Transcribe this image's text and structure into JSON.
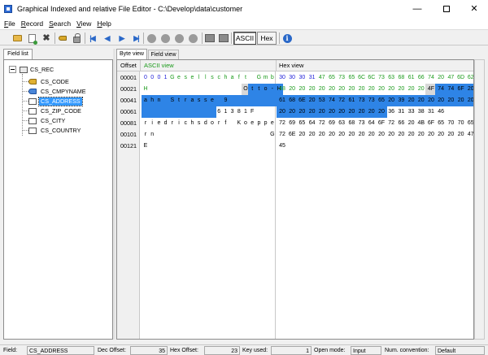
{
  "window": {
    "title": "Graphical Indexed and relative File Editor - C:\\Develop\\data\\customer",
    "min_glyph": "—",
    "close_glyph": "✕",
    "app_icon": "app-icon"
  },
  "menu": [
    "File",
    "Record",
    "Search",
    "View",
    "Help"
  ],
  "toolbar": {
    "icons": [
      "open-folder-icon",
      "new-document-icon",
      "delete-icon",
      "key-icon",
      "lock-icon",
      "first-record-icon",
      "previous-record-icon",
      "next-record-icon",
      "last-record-icon",
      "circle-icon",
      "circle-icon",
      "circle-icon",
      "circle-icon",
      "progress-icon",
      "progress-icon",
      "info-icon"
    ],
    "ascii_label": "ASCII",
    "hex_label": "Hex",
    "info_glyph": "i"
  },
  "left_tab": "Field list",
  "tree": {
    "root": "CS_REC",
    "items": [
      {
        "label": "CS_CODE",
        "icon": "key-icon"
      },
      {
        "label": "CS_CMPYNAME",
        "icon": "key-icon-blue"
      },
      {
        "label": "CS_ADDRESS",
        "icon": "field-icon",
        "selected": true
      },
      {
        "label": "CS_ZIP_CODE",
        "icon": "field-icon"
      },
      {
        "label": "CS_CITY",
        "icon": "field-icon"
      },
      {
        "label": "CS_COUNTRY",
        "icon": "field-icon"
      }
    ]
  },
  "view_tabs": {
    "byte": "Byte view",
    "field": "Field view"
  },
  "grid": {
    "offset_header": "Offset",
    "ascii_header": "ASCII view",
    "hex_header": "Hex view",
    "rows": [
      {
        "offset": "00001",
        "ascii": [
          "0",
          "0",
          "0",
          "1",
          "G",
          "e",
          "s",
          "e",
          "l",
          "l",
          "s",
          "c",
          "h",
          "a",
          "f",
          "t",
          " ",
          "G",
          "m",
          "b"
        ],
        "hex": [
          "30",
          "30",
          "30",
          "31",
          "47",
          "65",
          "73",
          "65",
          "6C",
          "6C",
          "73",
          "63",
          "68",
          "61",
          "66",
          "74",
          "20",
          "47",
          "6D",
          "62"
        ]
      },
      {
        "offset": "00021",
        "ascii": [
          "H",
          " ",
          " ",
          " ",
          " ",
          " ",
          " ",
          " ",
          " ",
          " ",
          " ",
          " ",
          " ",
          " ",
          " ",
          "O",
          "t",
          "t",
          "o",
          "-",
          "H"
        ],
        "hex": [
          "48",
          "20",
          "20",
          "20",
          "20",
          "20",
          "20",
          "20",
          "20",
          "20",
          "20",
          "20",
          "20",
          "20",
          "20",
          "4F",
          "74",
          "74",
          "6F",
          "20",
          "48"
        ]
      },
      {
        "offset": "00041",
        "ascii": [
          "a",
          "h",
          "n",
          " ",
          "S",
          "t",
          "r",
          "a",
          "s",
          "s",
          "e",
          " ",
          "9",
          " ",
          " ",
          " ",
          " ",
          " ",
          " ",
          " "
        ],
        "hex": [
          "61",
          "68",
          "6E",
          "20",
          "53",
          "74",
          "72",
          "61",
          "73",
          "73",
          "65",
          "20",
          "39",
          "20",
          "20",
          "20",
          "20",
          "20",
          "20",
          "20"
        ]
      },
      {
        "offset": "00061",
        "ascii": [
          " ",
          " ",
          " ",
          " ",
          " ",
          " ",
          " ",
          " ",
          " ",
          " ",
          " ",
          "6",
          "1",
          "3",
          "8",
          "1",
          "F"
        ],
        "hex": [
          "20",
          "20",
          "20",
          "20",
          "20",
          "20",
          "20",
          "20",
          "20",
          "20",
          "20",
          "36",
          "31",
          "33",
          "38",
          "31",
          "46"
        ]
      },
      {
        "offset": "00081",
        "ascii": [
          "r",
          "i",
          "e",
          "d",
          "r",
          "i",
          "c",
          "h",
          "s",
          "d",
          "o",
          "r",
          "f",
          " ",
          "K",
          "o",
          "e",
          "p",
          "p",
          "e"
        ],
        "hex": [
          "72",
          "69",
          "65",
          "64",
          "72",
          "69",
          "63",
          "68",
          "73",
          "64",
          "6F",
          "72",
          "66",
          "20",
          "4B",
          "6F",
          "65",
          "70",
          "70",
          "65"
        ]
      },
      {
        "offset": "00101",
        "ascii": [
          "r",
          "n",
          " ",
          " ",
          " ",
          " ",
          " ",
          " ",
          " ",
          " ",
          " ",
          " ",
          " ",
          " ",
          " ",
          " ",
          " ",
          " ",
          " ",
          "G"
        ],
        "hex": [
          "72",
          "6E",
          "20",
          "20",
          "20",
          "20",
          "20",
          "20",
          "20",
          "20",
          "20",
          "20",
          "20",
          "20",
          "20",
          "20",
          "20",
          "20",
          "20",
          "47"
        ]
      },
      {
        "offset": "00121",
        "ascii": [
          "E"
        ],
        "hex": [
          "45"
        ]
      }
    ]
  },
  "status": {
    "field_label": "Field:",
    "field_value": "CS_ADDRESS",
    "dec_label": "Dec Offset:",
    "dec_value": "35",
    "hexoff_label": "Hex Offset:",
    "hexoff_value": "23",
    "key_label": "Key used:",
    "key_value": "1",
    "open_label": "Open mode:",
    "open_value": "Input",
    "num_label": "Num. convention:",
    "num_value": "Default"
  }
}
